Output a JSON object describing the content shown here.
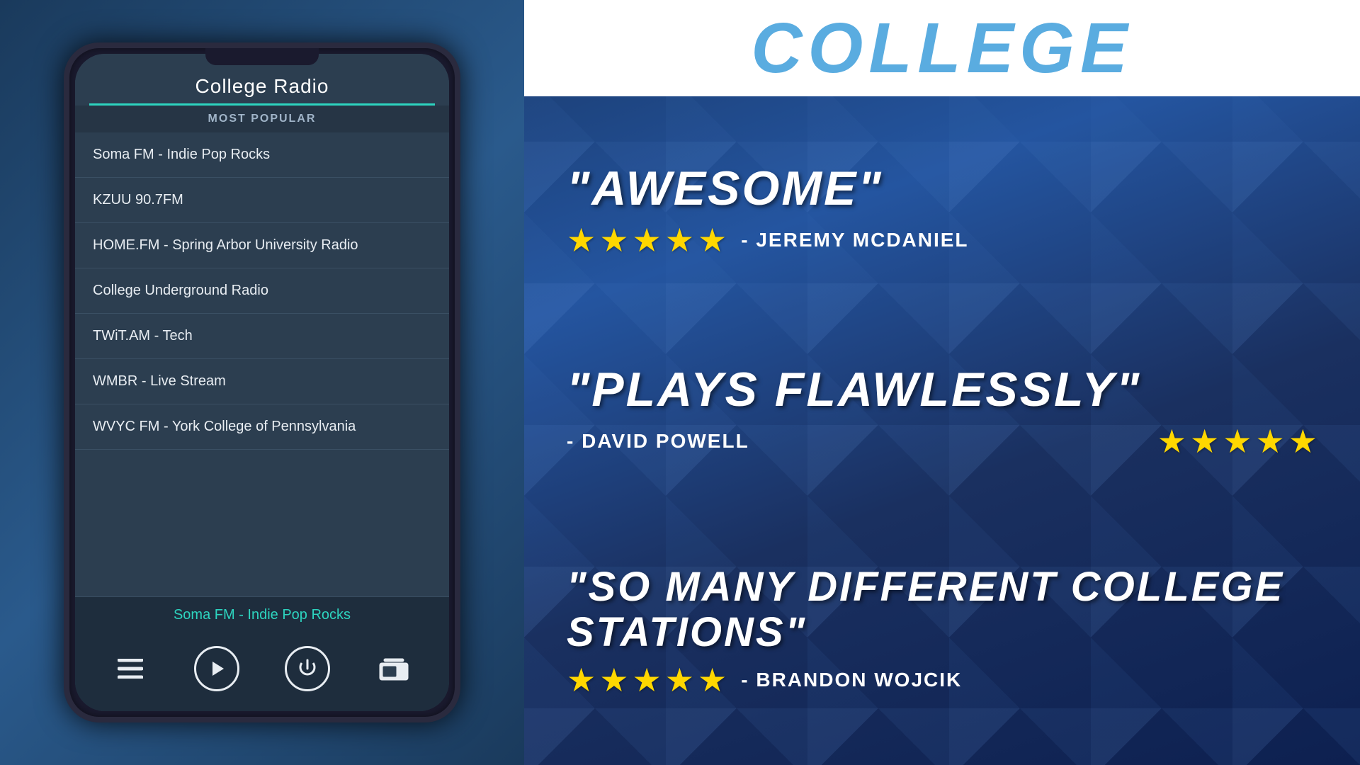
{
  "app": {
    "title": "College Radio",
    "most_popular_label": "MOST POPULAR",
    "stations": [
      {
        "name": "Soma FM - Indie Pop Rocks"
      },
      {
        "name": "KZUU 90.7FM"
      },
      {
        "name": "HOME.FM - Spring Arbor University Radio"
      },
      {
        "name": "College Underground Radio"
      },
      {
        "name": "TWiT.AM - Tech"
      },
      {
        "name": "WMBR - Live Stream"
      },
      {
        "name": "WVYC FM - York College of Pennsylvania"
      }
    ],
    "now_playing": "Soma FM - Indie Pop Rocks"
  },
  "right": {
    "college_label": "COLLEGE",
    "reviews": [
      {
        "quote": "\"AWESOME\"",
        "reviewer": "- JEREMY MCDANIEL",
        "stars": 5
      },
      {
        "quote": "\"PLAYS FLAWLESSLY\"",
        "reviewer": "- DAVID POWELL",
        "stars": 5
      },
      {
        "quote": "\"SO MANY DIFFERENT COLLEGE STATIONS\"",
        "reviewer": "- BRANDON WOJCIK",
        "stars": 5
      }
    ]
  },
  "icons": {
    "menu": "☰",
    "play": "▶",
    "power": "⏻",
    "radio": "📻",
    "star": "★"
  }
}
